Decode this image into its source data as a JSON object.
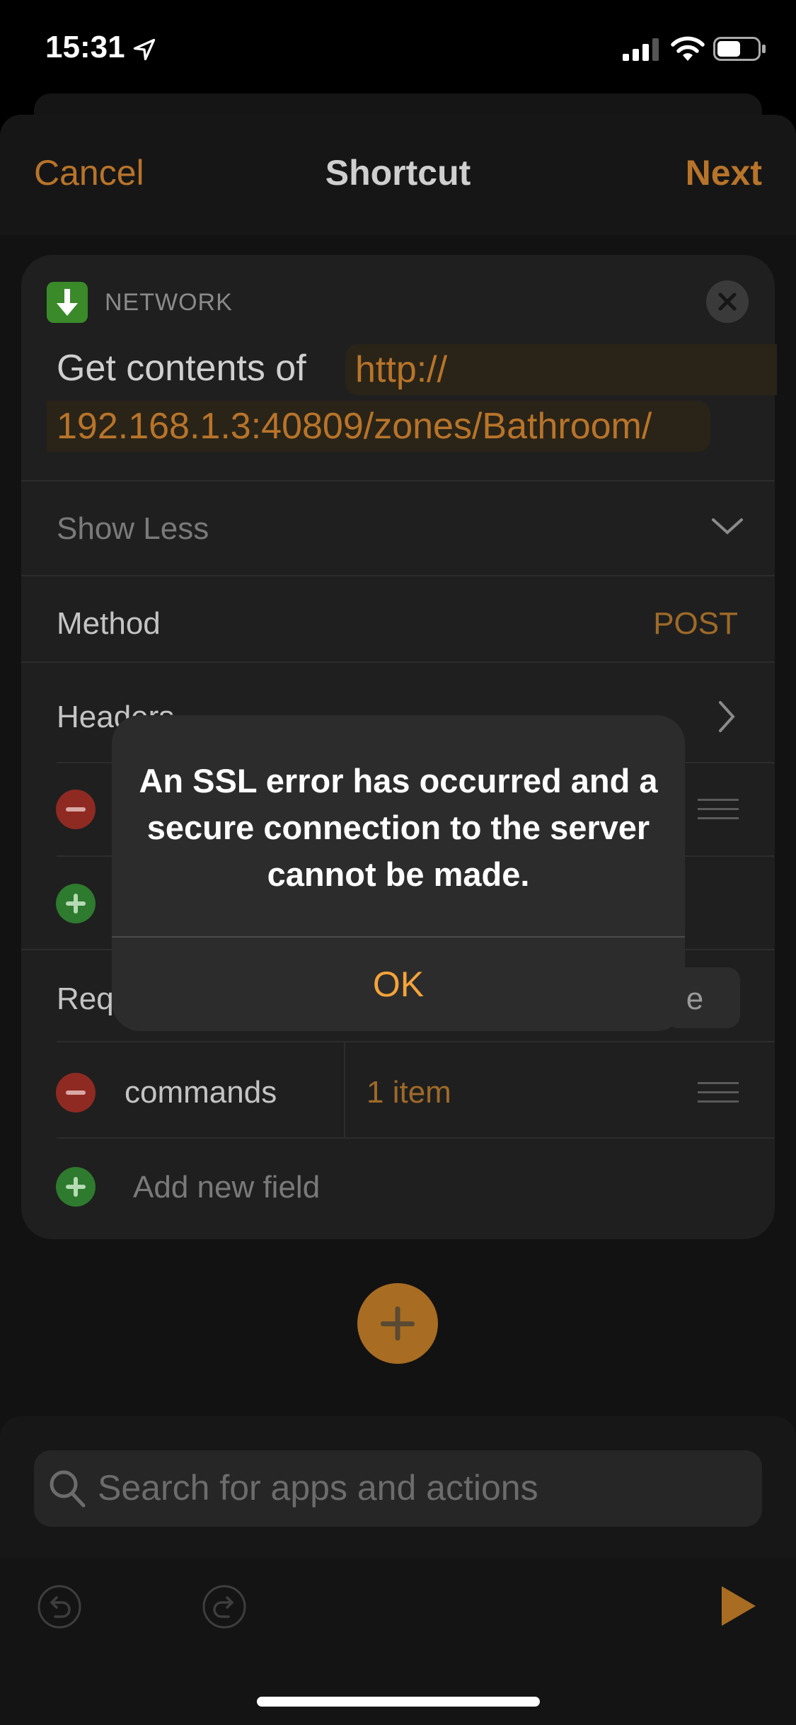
{
  "status_bar": {
    "time": "15:31"
  },
  "nav": {
    "cancel": "Cancel",
    "title": "Shortcut",
    "next": "Next"
  },
  "action": {
    "category": "NETWORK",
    "text": "Get contents of",
    "url_line1": "http://",
    "url_line2": "192.168.1.3:40809/zones/Bathroom/",
    "show_less": "Show Less",
    "method_label": "Method",
    "method_value": "POST",
    "headers_label": "Headers",
    "request_body_label": "Req",
    "segment_fragment": "le",
    "body_field_key": "commands",
    "body_field_value": "1 item",
    "add_field": "Add new field"
  },
  "search": {
    "placeholder": "Search for apps and actions"
  },
  "alert": {
    "message": "An SSL error has occurred and a secure connection to the server cannot be made.",
    "ok": "OK"
  },
  "colors": {
    "accent": "#f5a33a",
    "dimmed_accent": "#b8742a",
    "add": "#2e7a2e",
    "remove": "#8f2a22"
  }
}
